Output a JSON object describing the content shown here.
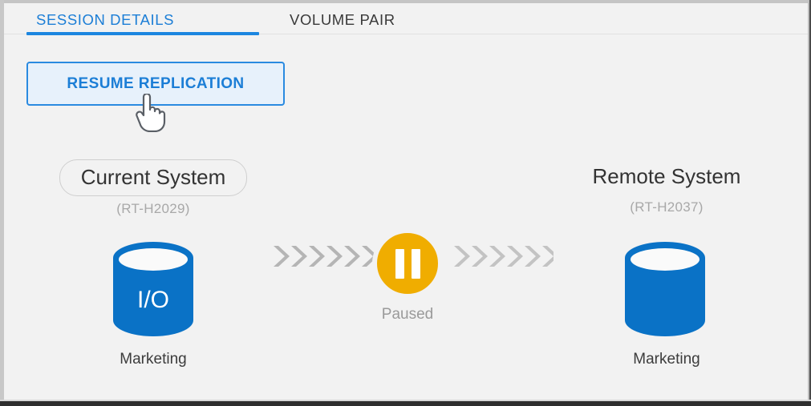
{
  "window": {
    "background_color": "#f2f2f2"
  },
  "tabs": {
    "items": [
      {
        "label": "SESSION DETAILS",
        "active": true
      },
      {
        "label": "VOLUME PAIR",
        "active": false
      }
    ],
    "active_color": "#1c7ed6",
    "inactive_color": "#3a3a3a",
    "underline_color": "#1c86e0"
  },
  "toolbar": {
    "resume_label": "RESUME REPLICATION",
    "resume_text_color": "#1c7ed6",
    "resume_fill_color": "#e7f1fb",
    "resume_border_color": "#2a8ae0"
  },
  "cursor": {
    "icon": "pointing-hand-cursor"
  },
  "diagram": {
    "source": {
      "title": "Current System",
      "id": "(RT-H2029)",
      "volume_label": "Marketing",
      "volume_badge": "I/O",
      "cylinder_color": "#0a72c6",
      "boxed": true
    },
    "target": {
      "title": "Remote System",
      "id": "(RT-H2037)",
      "volume_label": "Marketing",
      "volume_badge": "",
      "cylinder_color": "#0a72c6",
      "boxed": false
    },
    "flow": {
      "status_label": "Paused",
      "status_icon": "pause-icon",
      "status_color": "#f0ad00",
      "arrow_color": "#b5b5b5",
      "arrow_count_left": 6,
      "arrow_count_right": 6,
      "direction": "left-to-right"
    }
  }
}
